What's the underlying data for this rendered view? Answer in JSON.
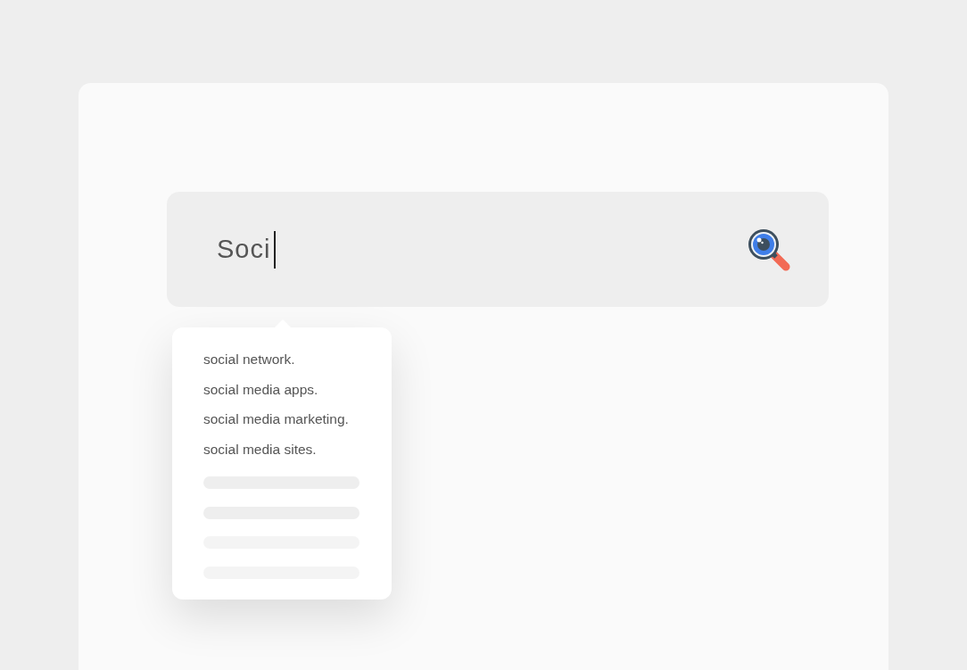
{
  "search": {
    "value": "Soci",
    "focused": true
  },
  "suggestions": [
    "social network.",
    "social media apps.",
    "social media marketing.",
    "social media sites."
  ]
}
